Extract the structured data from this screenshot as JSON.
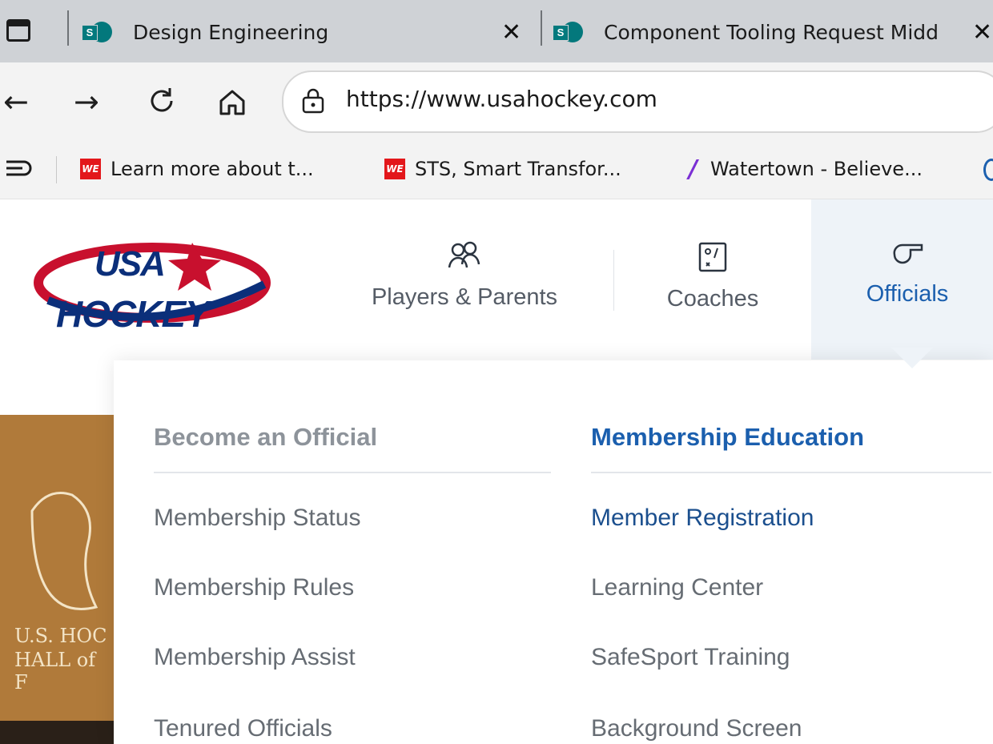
{
  "browser": {
    "tabs": [
      {
        "title": "Design Engineering",
        "icon": "sharepoint-icon",
        "close": "✕"
      },
      {
        "title": "Component Tooling Request Midd",
        "icon": "sharepoint-icon",
        "close": "✕"
      }
    ],
    "url": "https://www.usahockey.com",
    "bookmarks": [
      {
        "label": "Learn more about t...",
        "icon": "we-logo-icon"
      },
      {
        "label": "STS, Smart Transfor...",
        "icon": "we-logo-icon"
      },
      {
        "label": "Watertown - Believe...",
        "icon": "yahoo-slash-icon"
      }
    ],
    "icons": {
      "we_text": "WE",
      "sp_text": "S"
    }
  },
  "site": {
    "logo": {
      "top_text": "USA",
      "bottom_text": "HOCKEY"
    },
    "nav": [
      {
        "label": "Players & Parents",
        "icon": "players-icon"
      },
      {
        "label": "Coaches",
        "icon": "clipboard-icon"
      },
      {
        "label": "Officials",
        "icon": "whistle-icon",
        "active": true
      }
    ],
    "menu": {
      "left_column": {
        "heading": "Become an Official",
        "items": [
          "Membership Status",
          "Membership Rules",
          "Membership Assist",
          "Tenured Officials"
        ]
      },
      "right_column": {
        "heading": "Membership Education",
        "items": [
          "Member Registration",
          "Learning Center",
          "SafeSport Training",
          "Background Screen"
        ]
      }
    },
    "photo_text": {
      "line1": "U.S. HOC",
      "line2": "HALL of F"
    }
  },
  "colors": {
    "brand_blue": "#1b4f8e",
    "brand_red": "#d32f2f",
    "link_blue": "#1b5fae",
    "muted_text": "#666c73",
    "heading_muted": "#8d939a"
  }
}
